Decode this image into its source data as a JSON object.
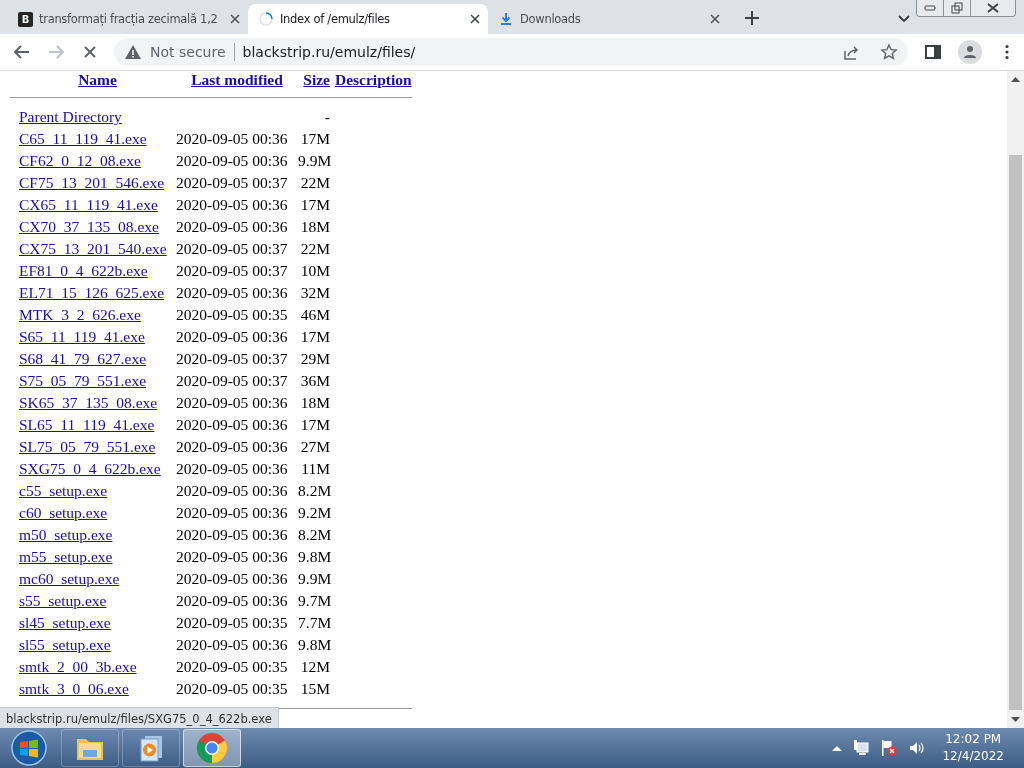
{
  "tabs": [
    {
      "title": "transformați fracția zecimală 1,2",
      "selected": false,
      "kind": "letter",
      "icon_letter": "B"
    },
    {
      "title": "Index of /emulz/files",
      "selected": true,
      "kind": "spinner"
    },
    {
      "title": "Downloads",
      "selected": false,
      "kind": "download"
    }
  ],
  "toolbar": {
    "security": "Not secure",
    "url": "blackstrip.ru/emulz/files/",
    "loading": true
  },
  "listing": {
    "columns": [
      "Name",
      "Last modified",
      "Size",
      "Description"
    ],
    "rows": [
      {
        "name": "Parent Directory",
        "date": "",
        "size": "-"
      },
      {
        "name": "C65_11_119_41.exe",
        "date": "2020-09-05 00:36",
        "size": "17M"
      },
      {
        "name": "CF62_0_12_08.exe",
        "date": "2020-09-05 00:36",
        "size": "9.9M"
      },
      {
        "name": "CF75_13_201_546.exe",
        "date": "2020-09-05 00:37",
        "size": "22M"
      },
      {
        "name": "CX65_11_119_41.exe",
        "date": "2020-09-05 00:36",
        "size": "17M"
      },
      {
        "name": "CX70_37_135_08.exe",
        "date": "2020-09-05 00:36",
        "size": "18M"
      },
      {
        "name": "CX75_13_201_540.exe",
        "date": "2020-09-05 00:37",
        "size": "22M"
      },
      {
        "name": "EF81_0_4_622b.exe",
        "date": "2020-09-05 00:37",
        "size": "10M"
      },
      {
        "name": "EL71_15_126_625.exe",
        "date": "2020-09-05 00:36",
        "size": "32M"
      },
      {
        "name": "MTK_3_2_626.exe",
        "date": "2020-09-05 00:35",
        "size": "46M"
      },
      {
        "name": "S65_11_119_41.exe",
        "date": "2020-09-05 00:36",
        "size": "17M"
      },
      {
        "name": "S68_41_79_627.exe",
        "date": "2020-09-05 00:37",
        "size": "29M"
      },
      {
        "name": "S75_05_79_551.exe",
        "date": "2020-09-05 00:37",
        "size": "36M"
      },
      {
        "name": "SK65_37_135_08.exe",
        "date": "2020-09-05 00:36",
        "size": "18M"
      },
      {
        "name": "SL65_11_119_41.exe",
        "date": "2020-09-05 00:36",
        "size": "17M"
      },
      {
        "name": "SL75_05_79_551.exe",
        "date": "2020-09-05 00:36",
        "size": "27M"
      },
      {
        "name": "SXG75_0_4_622b.exe",
        "date": "2020-09-05 00:36",
        "size": "11M"
      },
      {
        "name": "c55_setup.exe",
        "date": "2020-09-05 00:36",
        "size": "8.2M"
      },
      {
        "name": "c60_setup.exe",
        "date": "2020-09-05 00:36",
        "size": "9.2M"
      },
      {
        "name": "m50_setup.exe",
        "date": "2020-09-05 00:36",
        "size": "8.2M"
      },
      {
        "name": "m55_setup.exe",
        "date": "2020-09-05 00:36",
        "size": "9.8M"
      },
      {
        "name": "mc60_setup.exe",
        "date": "2020-09-05 00:36",
        "size": "9.9M"
      },
      {
        "name": "s55_setup.exe",
        "date": "2020-09-05 00:36",
        "size": "9.7M"
      },
      {
        "name": "sl45_setup.exe",
        "date": "2020-09-05 00:35",
        "size": "7.7M"
      },
      {
        "name": "sl55_setup.exe",
        "date": "2020-09-05 00:36",
        "size": "9.8M"
      },
      {
        "name": "smtk_2_00_3b.exe",
        "date": "2020-09-05 00:35",
        "size": "12M"
      },
      {
        "name": "smtk_3_0_06.exe",
        "date": "2020-09-05 00:35",
        "size": "15M"
      }
    ]
  },
  "status_url": "blackstrip.ru/emulz/files/SXG75_0_4_622b.exe",
  "taskbar": {
    "apps": [
      {
        "kind": "explorer",
        "selected": false
      },
      {
        "kind": "media",
        "selected": false
      },
      {
        "kind": "chrome",
        "selected": true
      }
    ],
    "time": "12:02 PM",
    "date": "12/4/2022"
  }
}
